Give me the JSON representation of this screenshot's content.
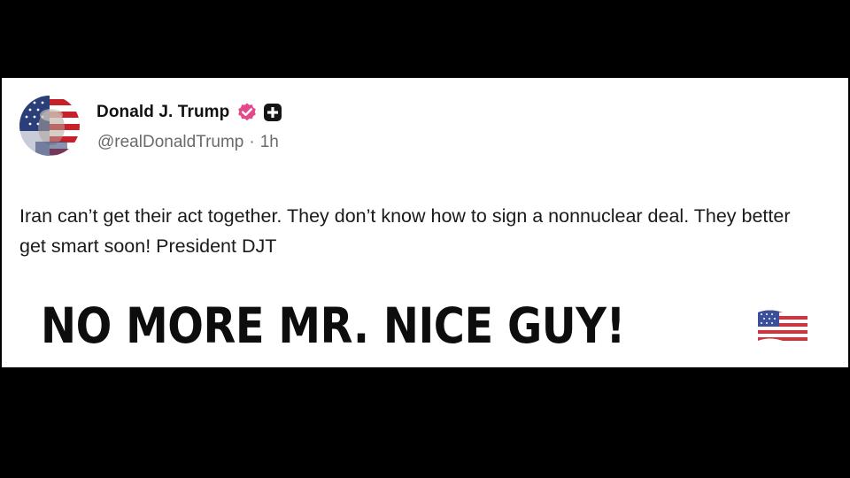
{
  "post": {
    "author": {
      "display_name": "Donald J. Trump",
      "handle": "@realDonaldTrump",
      "verified_icon": "verified-check-icon",
      "badge_icon": "plus-badge-icon",
      "avatar": "profile-avatar-flag-portrait"
    },
    "meta": {
      "separator": "·",
      "time_ago": "1h"
    },
    "body": "Iran can’t get their act together. They don’t know how to sign a nonnuclear deal. They better get smart soon! President DJT",
    "shout": "NO MORE MR. NICE GUY!",
    "emoji": "us-flag-icon"
  },
  "colors": {
    "background": "#000000",
    "card": "#ffffff",
    "verified": "#e24a8d",
    "text": "#1a1a1a",
    "muted": "#6b6b6b"
  }
}
